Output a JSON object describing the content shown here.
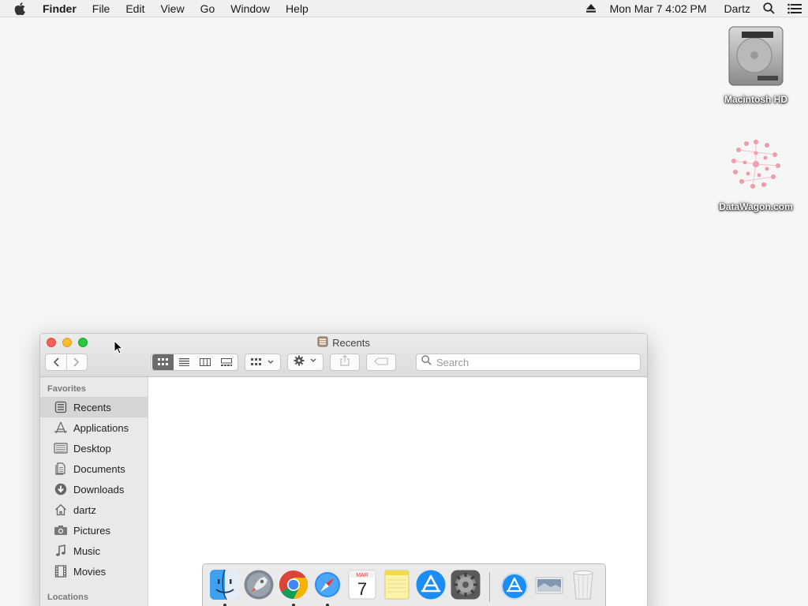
{
  "menubar": {
    "app_name": "Finder",
    "menus": [
      "File",
      "Edit",
      "View",
      "Go",
      "Window"
    ],
    "help": "Help",
    "clock": "Mon Mar 7  4:02 PM",
    "user": "Dartz",
    "icons": [
      "apple-icon",
      "eject-icon",
      "spotlight-icon",
      "notification-center-icon"
    ]
  },
  "desktop": {
    "icons": [
      {
        "label": "Macintosh HD",
        "icon": "hard-drive-icon"
      },
      {
        "label": "DataWagon.com",
        "icon": "datawagon-logo-icon"
      }
    ]
  },
  "finder": {
    "title": "Recents",
    "title_icon": "recents-icon",
    "search": {
      "placeholder": "Search",
      "value": ""
    },
    "toolbar": {
      "views": [
        "icon-view",
        "list-view",
        "column-view",
        "gallery-view"
      ],
      "active_view": "icon-view",
      "buttons": [
        "back",
        "forward",
        "arrange",
        "action",
        "share",
        "tags"
      ]
    },
    "sidebar": {
      "favorites_heading": "Favorites",
      "locations_heading": "Locations",
      "items": [
        {
          "label": "Recents",
          "icon": "recents-icon",
          "selected": true
        },
        {
          "label": "Applications",
          "icon": "applications-icon"
        },
        {
          "label": "Desktop",
          "icon": "desktop-icon"
        },
        {
          "label": "Documents",
          "icon": "documents-icon"
        },
        {
          "label": "Downloads",
          "icon": "downloads-icon"
        },
        {
          "label": "dartz",
          "icon": "home-icon"
        },
        {
          "label": "Pictures",
          "icon": "pictures-icon"
        },
        {
          "label": "Music",
          "icon": "music-icon"
        },
        {
          "label": "Movies",
          "icon": "movies-icon"
        }
      ]
    }
  },
  "dock": {
    "apps": [
      {
        "icon": "finder-icon",
        "running": true
      },
      {
        "icon": "launchpad-icon",
        "running": false
      },
      {
        "icon": "chrome-icon",
        "running": true
      },
      {
        "icon": "safari-icon",
        "running": true
      },
      {
        "icon": "calendar-icon",
        "running": false,
        "month": "MAR",
        "day": "7"
      },
      {
        "icon": "notes-icon",
        "running": false
      },
      {
        "icon": "app-store-icon",
        "running": false
      },
      {
        "icon": "system-preferences-icon",
        "running": false
      }
    ],
    "others": [
      {
        "icon": "applications-folder-icon"
      },
      {
        "icon": "preview-image-icon"
      },
      {
        "icon": "trash-icon"
      }
    ]
  },
  "colors": {
    "close": "#fc5f57",
    "minimize": "#fdbc2e",
    "maximize": "#28c840",
    "sidebar_selected": "#d5d5d5"
  }
}
